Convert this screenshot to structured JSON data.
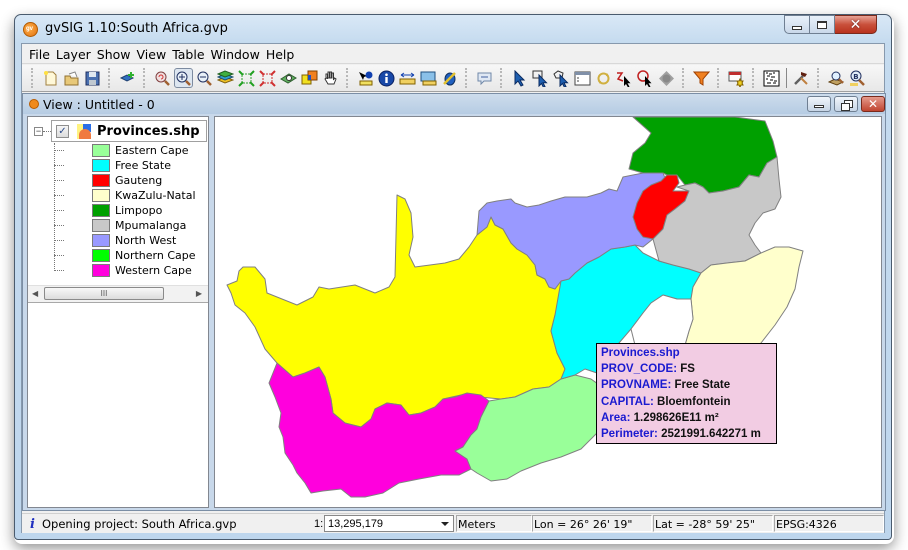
{
  "window": {
    "title": "gvSIG 1.10:South Africa.gvp",
    "app_icon_text": "gv"
  },
  "menu": [
    "File",
    "Layer",
    "Show",
    "View",
    "Table",
    "Window",
    "Help"
  ],
  "toolbar": {
    "buttons": [
      {
        "name": "new-document-icon",
        "group": 1
      },
      {
        "name": "open-folder-icon",
        "group": 1
      },
      {
        "name": "save-icon",
        "group": 1
      },
      {
        "name": "add-layer-icon",
        "group": 2
      },
      {
        "name": "zoom-previous-icon",
        "group": 3
      },
      {
        "name": "zoom-in-icon",
        "group": 3,
        "active": true
      },
      {
        "name": "zoom-out-icon",
        "group": 3
      },
      {
        "name": "zoom-to-layers-icon",
        "group": 3
      },
      {
        "name": "zoom-full-extent-icon",
        "group": 3
      },
      {
        "name": "zoom-select-icon",
        "group": 3
      },
      {
        "name": "locator-icon",
        "group": 3
      },
      {
        "name": "overlay-icon",
        "group": 3
      },
      {
        "name": "pan-hand-icon",
        "group": 3
      },
      {
        "name": "information-by-point-icon",
        "group": 4
      },
      {
        "name": "info-icon",
        "group": 4
      },
      {
        "name": "measure-distance-icon",
        "group": 4
      },
      {
        "name": "measure-area-icon",
        "group": 4
      },
      {
        "name": "hyperlink-icon",
        "group": 4
      },
      {
        "name": "maptip-icon",
        "group": 5
      },
      {
        "name": "select-pointer-icon",
        "group": 6
      },
      {
        "name": "select-rectangle-icon",
        "group": 6
      },
      {
        "name": "select-polygon-icon",
        "group": 6
      },
      {
        "name": "attribute-table-icon",
        "group": 6
      },
      {
        "name": "invert-selection-icon",
        "group": 6
      },
      {
        "name": "select-polyline-icon",
        "group": 6
      },
      {
        "name": "select-circle-icon",
        "group": 6
      },
      {
        "name": "select-buffer-icon",
        "group": 6
      },
      {
        "name": "filter-icon",
        "group": 7
      },
      {
        "name": "table-settings-icon",
        "group": 8
      },
      {
        "name": "raster-icon",
        "group": 9
      },
      {
        "name": "tools-icon",
        "group": 9
      },
      {
        "name": "catalog-search-icon",
        "group": 10
      },
      {
        "name": "gazetteer-search-icon",
        "group": 10
      }
    ]
  },
  "view": {
    "title": "View : Untitled - 0"
  },
  "toc": {
    "layer_name": "Provinces.shp",
    "layer_checked": true,
    "expander": "−",
    "check_mark": "✓",
    "legend": [
      {
        "label": "Eastern Cape",
        "color": "#99ff99"
      },
      {
        "label": "Free State",
        "color": "#00ffff"
      },
      {
        "label": "Gauteng",
        "color": "#ff0000"
      },
      {
        "label": "KwaZulu-Natal",
        "color": "#ffffcc"
      },
      {
        "label": "Limpopo",
        "color": "#00a000"
      },
      {
        "label": "Mpumalanga",
        "color": "#c8c8c8"
      },
      {
        "label": "North West",
        "color": "#9999ff"
      },
      {
        "label": "Northern Cape",
        "color": "#00ff00"
      },
      {
        "label": "Western Cape",
        "color": "#ff00dd"
      }
    ],
    "scroll_thumb_grip": "III"
  },
  "map": {
    "province_colors": {
      "northern_cape": "#ffff00",
      "western_cape": "#ff00dd",
      "eastern_cape": "#99ff99",
      "free_state": "#00ffff",
      "north_west": "#9999ff",
      "gauteng": "#ff0000",
      "limpopo": "#00a000",
      "mpumalanga": "#c8c8c8",
      "kwazulu_natal": "#ffffcc"
    },
    "outline_color": "#808080"
  },
  "info_tooltip": {
    "title": "Provinces.shp",
    "fields": [
      {
        "key": "PROV_CODE:",
        "value": "FS"
      },
      {
        "key": "PROVNAME:",
        "value": "Free State"
      },
      {
        "key": "CAPITAL:",
        "value": "Bloemfontein"
      },
      {
        "key": "Area:",
        "value": "1.298626E11 m²"
      },
      {
        "key": "Perimeter:",
        "value": "2521991.642271 m"
      }
    ]
  },
  "statusbar": {
    "info_icon": "i",
    "message": "Opening project: South Africa.gvp",
    "scale_prefix": "1:",
    "scale_value": "13,295,179",
    "units": "Meters",
    "lon": "Lon = 26° 26' 19\"",
    "lat": "Lat = -28° 59' 25\"",
    "crs": "EPSG:4326"
  }
}
